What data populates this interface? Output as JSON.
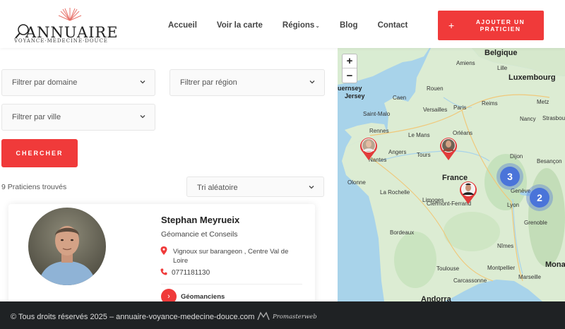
{
  "logo": {
    "title": "ANNUAIRE",
    "subtitle": "VOYANCE·MEDECINE·DOUCE"
  },
  "nav": {
    "items": [
      "Accueil",
      "Voir la carte",
      "Régions",
      "Blog",
      "Contact"
    ],
    "regions_caret": "⌄"
  },
  "header_button": {
    "plus": "+",
    "label": "AJOUTER UN PRATICIEN"
  },
  "filters": {
    "domain_placeholder": "Filtrer par domaine",
    "region_placeholder": "Filtrer par région",
    "city_placeholder": "Filtrer par ville",
    "search_label": "CHERCHER"
  },
  "results": {
    "count_text": "9 Praticiens trouvés",
    "sort_label": "Tri aléatoire"
  },
  "card": {
    "name": "Stephan Meyrueix",
    "specialty": "Géomancie et Conseils",
    "location": "Vignoux sur barangeon , Centre Val de Loire",
    "phone": "0771181130",
    "category_arrow": "›",
    "category": "Géomanciens"
  },
  "map": {
    "zoom_in": "+",
    "zoom_out": "−",
    "countries": {
      "belgique": "Belgique",
      "luxembourg": "Luxembourg",
      "france": "France"
    },
    "cities": {
      "guernsey": "uernsey",
      "jersey": "Jersey",
      "caen": "Caen",
      "rouen": "Rouen",
      "amiens": "Amiens",
      "lille": "Lille",
      "reims": "Reims",
      "saint_malo": "Saint-Malo",
      "rennes": "Rennes",
      "le_mans": "Le Mans",
      "versailles": "Versailles",
      "paris": "Paris",
      "metz": "Metz",
      "strasbourg": "Strasbourg",
      "nancy": "Nancy",
      "angers": "Angers",
      "tours": "Tours",
      "orleans": "Orléans",
      "dijon": "Dijon",
      "besancon": "Besançon",
      "nantes": "Nantes",
      "la_rochelle": "La Rochelle",
      "limoges": "Limoges",
      "clermont": "Clermont-Ferrand",
      "lyon": "Lyon",
      "geneve": "Genève",
      "grenoble": "Grenoble",
      "bordeaux": "Bordeaux",
      "nimes": "Nîmes",
      "toulouse": "Toulouse",
      "montpellier": "Montpellier",
      "carcassonne": "Carcassonne",
      "marseille": "Marseille",
      "andorra": "Andorra",
      "olonne": "Olonne",
      "mona": "Mona"
    },
    "clusters": [
      "3",
      "2"
    ]
  },
  "footer": {
    "copyright": "© Tous droits réservés 2025 – annuaire-voyance-medecine-douce.com",
    "brand": "Promasterweb"
  },
  "colors": {
    "accent": "#f03a3a",
    "footer_bg": "#1f2224",
    "cluster": "#4a74d9",
    "water": "#a8d3ea",
    "land": "#d9ecd2"
  }
}
